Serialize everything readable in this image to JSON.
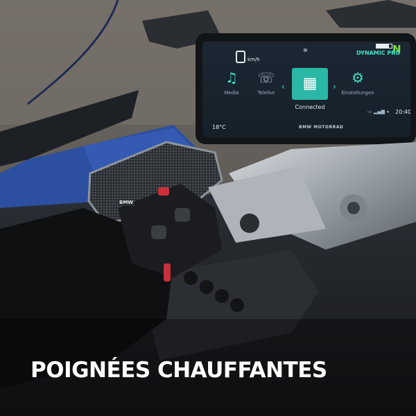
{
  "display": {
    "speed_unit": "km/h",
    "riding_mode": "DYNAMIC PRO",
    "gear": "N",
    "menu": [
      {
        "label": "Media",
        "icon": "music-note-icon"
      },
      {
        "label": "Telefon",
        "icon": "phone-icon"
      },
      {
        "label": "Connected",
        "icon": "grid-icon",
        "selected": true
      },
      {
        "label": "Einstellungen",
        "icon": "gear-icon"
      }
    ],
    "temperature": "18°C",
    "time": "20:40",
    "brand": "BMW MOTORRAD"
  },
  "speaker_logo": "BMW",
  "caption": "POIGNÉES CHAUFFANTES"
}
